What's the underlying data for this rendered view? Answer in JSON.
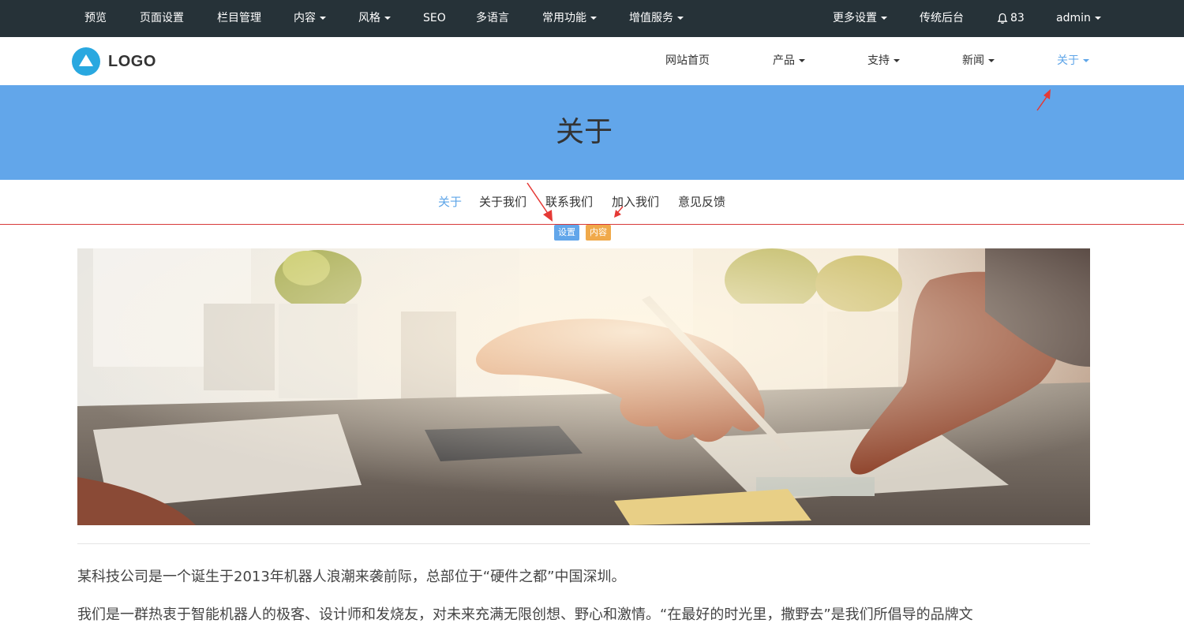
{
  "admin_bar": {
    "items": [
      "预览",
      "页面设置",
      "栏目管理",
      "内容",
      "风格",
      "SEO",
      "多语言",
      "常用功能",
      "增值服务"
    ],
    "right_items": [
      "更多设置",
      "传统后台"
    ],
    "notification_count": "83",
    "user": "admin"
  },
  "header": {
    "logo_text": "LOGO",
    "nav": [
      "网站首页",
      "产品",
      "支持",
      "新闻",
      "关于"
    ]
  },
  "banner": {
    "title": "关于"
  },
  "subnav": {
    "items": [
      "关于",
      "关于我们",
      "联系我们",
      "加入我们",
      "意见反馈"
    ]
  },
  "badges": {
    "settings": "设置",
    "content": "内容"
  },
  "content": {
    "p1": "某科技公司是一个诞生于2013年机器人浪潮来袭前际，总部位于“硬件之都”中国深圳。",
    "p2": "我们是一群热衷于智能机器人的极客、设计师和发烧友，对未来充满无限创想、野心和激情。“在最好的时光里，撒野去”是我们所倡导的品牌文"
  },
  "colors": {
    "admin_bar": "#263238",
    "accent": "#5ea5e8",
    "banner": "#62a6ea",
    "badge_orange": "#f0a94a",
    "arrow": "#e53935"
  }
}
